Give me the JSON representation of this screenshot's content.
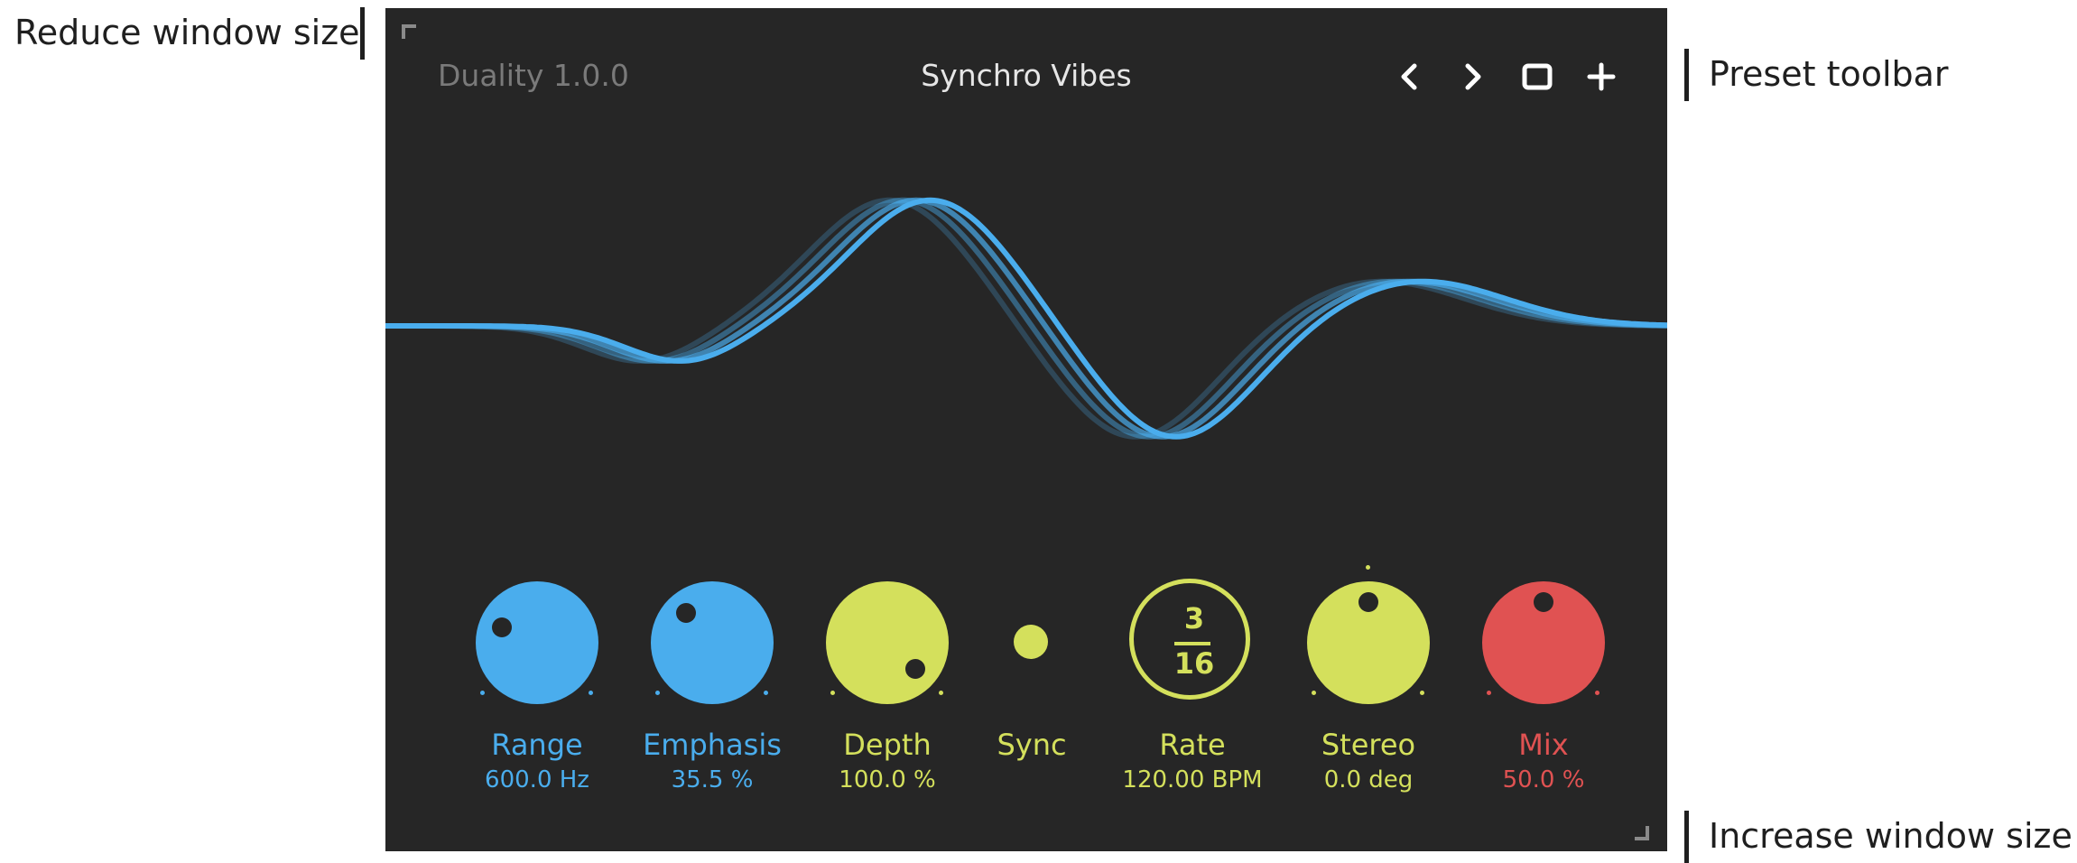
{
  "annotations": {
    "reduce": "Reduce window size",
    "preset": "Preset toolbar",
    "increase": "Increase window size"
  },
  "plugin": {
    "app_title": "Duality 1.0.0",
    "preset_name": "Synchro Vibes"
  },
  "toolbar": {
    "prev_icon": "chevron-left-icon",
    "next_icon": "chevron-right-icon",
    "save_icon": "square-icon",
    "add_icon": "plus-icon"
  },
  "knobs": [
    {
      "id": "range",
      "label": "Range",
      "value": "600.0 Hz",
      "color": "#4aaded"
    },
    {
      "id": "emphasis",
      "label": "Emphasis",
      "value": "35.5 %",
      "color": "#4aaded"
    },
    {
      "id": "depth",
      "label": "Depth",
      "value": "100.0 %",
      "color": "#d4e05c"
    },
    {
      "id": "sync",
      "label": "Sync",
      "value": "",
      "color": "#d4e05c"
    },
    {
      "id": "rate",
      "label": "Rate",
      "value": "120.00 BPM",
      "numerator": "3",
      "denominator": "16",
      "color": "#d4e05c"
    },
    {
      "id": "stereo",
      "label": "Stereo",
      "value": "0.0 deg",
      "color": "#d4e05c"
    },
    {
      "id": "mix",
      "label": "Mix",
      "value": "50.0 %",
      "color": "#e05252"
    }
  ],
  "colors": {
    "background": "#262626",
    "blue": "#4aaded",
    "yellow": "#d4e05c",
    "red": "#e05252"
  }
}
